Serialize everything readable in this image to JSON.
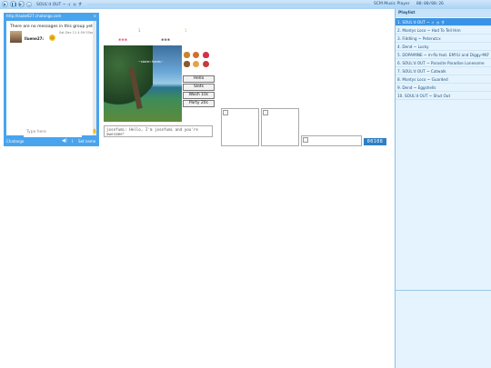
{
  "player": {
    "now_playing": "SOUL'd OUT ~ ィ ヵ す",
    "title": "SCM Music Player",
    "time": "00:00/00:26",
    "controls": [
      "play-icon",
      "pause-icon",
      "next-icon"
    ]
  },
  "chat": {
    "url": "http://lauke627.chatango.com",
    "close": "×",
    "empty_message": "There are no messages in this group yet.",
    "timestamp": "Sat Dec 11 4:59:35am",
    "username": "lluene27:",
    "input_placeholder": "Type here",
    "footer_brand": "Chatango",
    "footer_divider": "I",
    "set_name": "Set name"
  },
  "center": {
    "marker_green": "1",
    "marker_yellow": "1",
    "hearts_left": "❀❀❀",
    "hearts_right": "❀❀❀",
    "image_caption": "~stolen fronts~",
    "buttons": [
      "Hello",
      "Slots",
      "Wash 10c",
      "Party 20c"
    ],
    "speech": "josefumi: Hello, I'm josefumi and you're awesome!",
    "counter": "00108"
  },
  "playlist": {
    "header": "Playlist",
    "items": [
      "1. SOUL'd OUT ~ ィ ヵ す",
      "2. Montys Loco ~ Had To Tell Him",
      "3. Fiddling ~ Peterutcx",
      "4. Dend ~ Lucky",
      "5. DOPAMINE ~ m-flo feat. EMYLI and Diggy-MO'",
      "6. SOUL'd OUT ~ Parasite Paradise Lonesome",
      "7. SOUL'd OUT ~ Catwalk",
      "8. Montys Loco ~ Guarded",
      "9. Dend ~ Eggshells",
      "10. SOUL'd OUT ~ Shut Out"
    ],
    "selected_index": 0
  },
  "colors": {
    "accent": "#49a4ee",
    "selected": "#3a93e6",
    "counter_bg": "#2e7fc4"
  }
}
